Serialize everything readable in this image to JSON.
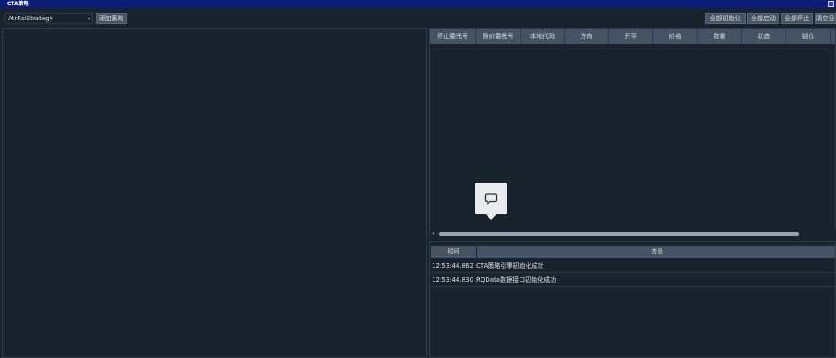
{
  "window": {
    "title": "CTA策略"
  },
  "toolbar": {
    "strategy_select": "AtrRsiStrategy",
    "add_strategy": "添加策略",
    "init_all": "全部初始化",
    "start_all": "全部启动",
    "stop_all": "全部停止",
    "clear": "清空日"
  },
  "orders_table": {
    "headers": [
      "停止委托号",
      "限价委托号",
      "本地代码",
      "方向",
      "开平",
      "价格",
      "数量",
      "状态",
      "锁仓"
    ]
  },
  "log_table": {
    "headers": {
      "time": "时间",
      "message": "信息"
    },
    "rows": [
      {
        "time": "12:53:44.862",
        "message": "CTA策略引擎初始化成功"
      },
      {
        "time": "12:53:44.830",
        "message": "RQData数据接口初始化成功"
      }
    ]
  },
  "icons": {
    "tooltip": "chat-bubble-icon",
    "combo_arrow": "chevron-down-icon"
  },
  "colors": {
    "background": "#19232d",
    "titlebar": "#0c1e7a",
    "header": "#455364",
    "text": "#dfe1e2"
  }
}
